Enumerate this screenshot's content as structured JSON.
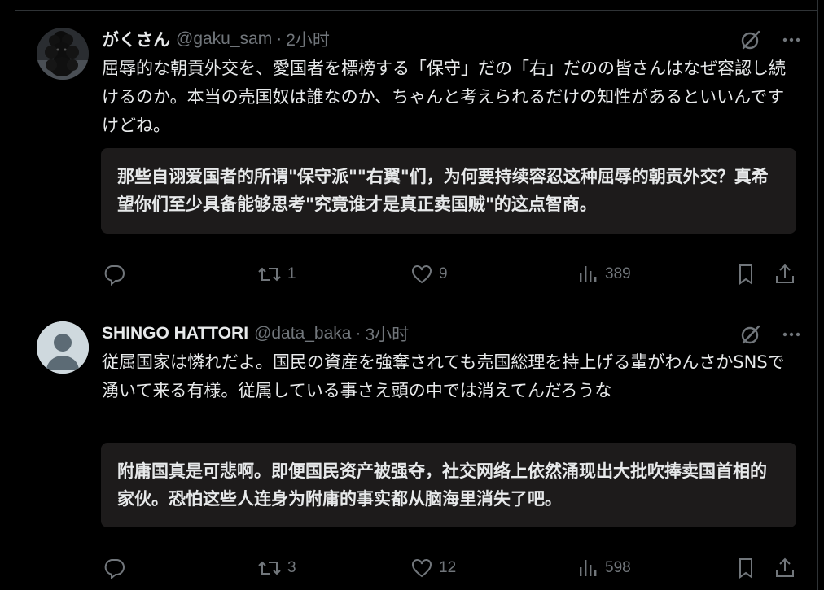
{
  "posts": [
    {
      "author_name": "がくさん",
      "handle": "@gaku_sam",
      "separator": "·",
      "time": "2小时",
      "text": "屈辱的な朝貢外交を、愛国者を標榜する「保守」だの「右」だのの皆さんはなぜ容認し続けるのか。本当の売国奴は誰なのか、ちゃんと考えられるだけの知性があるといいんですけどね。",
      "translation": "那些自诩爱国者的所谓\"保守派\"\"右翼\"们，为何要持续容忍这种屈辱的朝贡外交？真希望你们至少具备能够思考\"究竟谁才是真正卖国贼\"的这点智商。",
      "reply_count": "",
      "retweet_count": "1",
      "like_count": "9",
      "view_count": "389",
      "avatar_icon": "poodle-avatar"
    },
    {
      "author_name": "SHINGO HATTORI",
      "handle": "@data_baka",
      "separator": "·",
      "time": "3小时",
      "text": "従属国家は憐れだよ。国民の資産を強奪されても売国総理を持上げる輩がわんさかSNSで湧いて来る有様。従属している事さえ頭の中では消えてんだろうな",
      "translation": "附庸国真是可悲啊。即便国民资产被强夺，社交网络上依然涌现出大批吹捧卖国首相的家伙。恐怕这些人连身为附庸的事实都从脑海里消失了吧。",
      "reply_count": "",
      "retweet_count": "3",
      "like_count": "12",
      "view_count": "598",
      "avatar_icon": "default-user-avatar"
    }
  ],
  "icons": {
    "translate": "grok-translate-icon",
    "more": "more-icon",
    "reply": "reply-icon",
    "retweet": "retweet-icon",
    "like": "heart-icon",
    "views": "views-chart-icon",
    "bookmark": "bookmark-icon",
    "share": "share-icon"
  },
  "colors": {
    "background": "#000000",
    "text_primary": "#e7e9ea",
    "text_secondary": "#71767b",
    "divider": "#2f3336",
    "translation_box": "#1d1b1b"
  }
}
